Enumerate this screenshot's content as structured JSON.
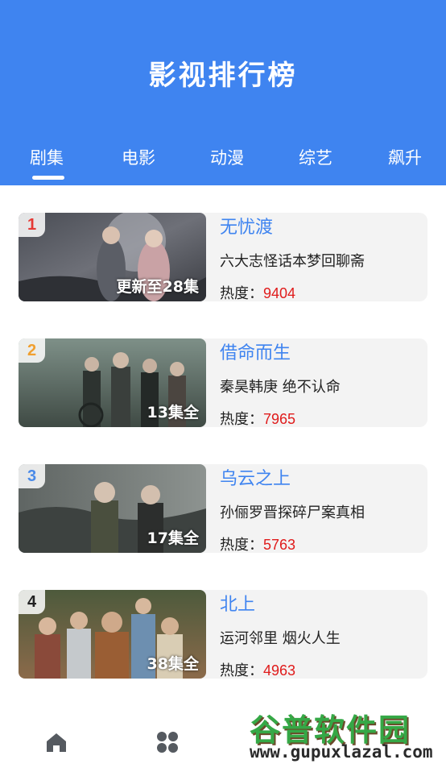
{
  "header": {
    "title": "影视排行榜"
  },
  "tabs": [
    {
      "label": "剧集",
      "active": true
    },
    {
      "label": "电影",
      "active": false
    },
    {
      "label": "动漫",
      "active": false
    },
    {
      "label": "综艺",
      "active": false
    },
    {
      "label": "飙升",
      "active": false
    }
  ],
  "list": [
    {
      "rank": "1",
      "rank_color": "#e53935",
      "episode": "更新至28集",
      "title": "无忧渡",
      "desc": "六大志怪话本梦回聊斋",
      "heat_label": "热度：",
      "heat": "9404",
      "thumb_text": "无忧渡"
    },
    {
      "rank": "2",
      "rank_color": "#f0a030",
      "episode": "13集全",
      "title": "借命而生",
      "desc": "秦昊韩庚 绝不认命",
      "heat_label": "热度：",
      "heat": "7965",
      "thumb_text": "借命而生"
    },
    {
      "rank": "3",
      "rank_color": "#4a8ae8",
      "episode": "17集全",
      "title": "乌云之上",
      "desc": "孙俪罗晋探碎尸案真相",
      "heat_label": "热度：",
      "heat": "5763",
      "thumb_text": "乌云之上"
    },
    {
      "rank": "4",
      "rank_color": "#222222",
      "episode": "38集全",
      "title": "北上",
      "desc": "运河邻里 烟火人生",
      "heat_label": "热度：",
      "heat": "4963",
      "thumb_text": ""
    }
  ],
  "bottom_nav": [
    {
      "icon": "home-icon"
    },
    {
      "icon": "grid-icon"
    }
  ],
  "watermark": {
    "text": "谷普软件园",
    "url": "www.gupuxlazal.com"
  },
  "colors": {
    "primary": "#3f84f0",
    "heat": "#e01b1b",
    "card_bg": "#f3f3f3"
  }
}
